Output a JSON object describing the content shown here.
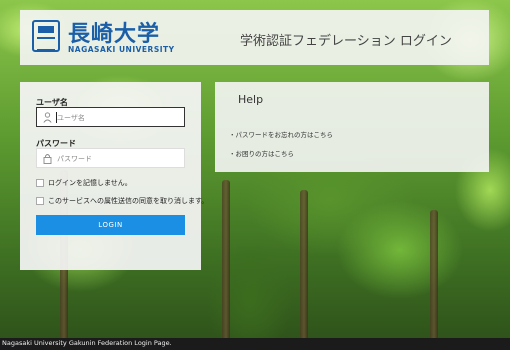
{
  "header": {
    "logo_jp": "長崎大学",
    "logo_en": "NAGASAKI UNIVERSITY",
    "title": "学術認証フェデレーション ログイン"
  },
  "login": {
    "username_label": "ユーザ名",
    "username_placeholder": "ユーザ名",
    "username_icon": "user-icon",
    "password_label": "パスワード",
    "password_placeholder": "パスワード",
    "password_icon": "lock-icon",
    "checkbox_remember": "ログインを記憶しません。",
    "checkbox_revoke": "このサービスへの属性送信の同意を取り消します。",
    "button_label": "LOGIN"
  },
  "help": {
    "title": "Help",
    "links": [
      "パスワードをお忘れの方はこちら",
      "お困りの方はこちら"
    ]
  },
  "footer": {
    "text": "Nagasaki University Gakunin Federation Login Page."
  },
  "colors": {
    "brand": "#1a5fa8",
    "button": "#1a8fe3"
  }
}
